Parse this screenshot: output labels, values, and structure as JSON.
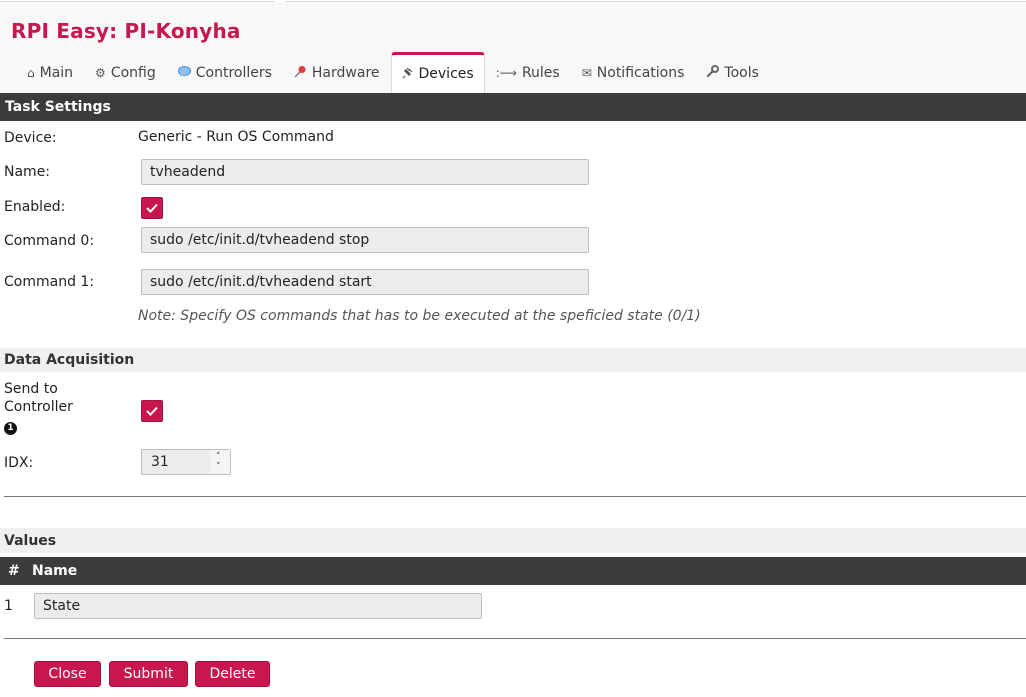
{
  "app": {
    "title": "RPI Easy: PI-Konyha"
  },
  "menu": [
    {
      "label": "Main",
      "icon": "home-icon"
    },
    {
      "label": "Config",
      "icon": "gear-icon"
    },
    {
      "label": "Controllers",
      "icon": "speech-bubble-icon"
    },
    {
      "label": "Hardware",
      "icon": "pushpin-icon"
    },
    {
      "label": "Devices",
      "icon": "plug-icon",
      "active": true
    },
    {
      "label": "Rules",
      "icon": "arrow-right-icon"
    },
    {
      "label": "Notifications",
      "icon": "envelope-icon"
    },
    {
      "label": "Tools",
      "icon": "wrench-icon"
    }
  ],
  "task_settings": {
    "heading": "Task Settings",
    "device_label": "Device:",
    "device_value": "Generic - Run OS Command",
    "name_label": "Name:",
    "name_value": "tvheadend",
    "enabled_label": "Enabled:",
    "enabled": true,
    "command0_label": "Command 0:",
    "command0_value": "sudo /etc/init.d/tvheadend stop",
    "command1_label": "Command 1:",
    "command1_value": "sudo /etc/init.d/tvheadend start",
    "note": "Note: Specify OS commands that has to be executed at the speficied state (0/1)"
  },
  "data_acquisition": {
    "heading": "Data Acquisition",
    "send_label_line1": "Send to",
    "send_label_line2": "Controller",
    "info_icon_text": "1",
    "send_to_controller": true,
    "idx_label": "IDX:",
    "idx_value": "31"
  },
  "values": {
    "heading": "Values",
    "col_num": "#",
    "col_name": "Name",
    "rows": [
      {
        "num": "1",
        "name": "State"
      }
    ]
  },
  "buttons": {
    "close": "Close",
    "submit": "Submit",
    "delete": "Delete"
  },
  "colors": {
    "accent": "#c8174c",
    "dark_bar": "#3b3b3b",
    "light_bar": "#f0f0f0"
  }
}
